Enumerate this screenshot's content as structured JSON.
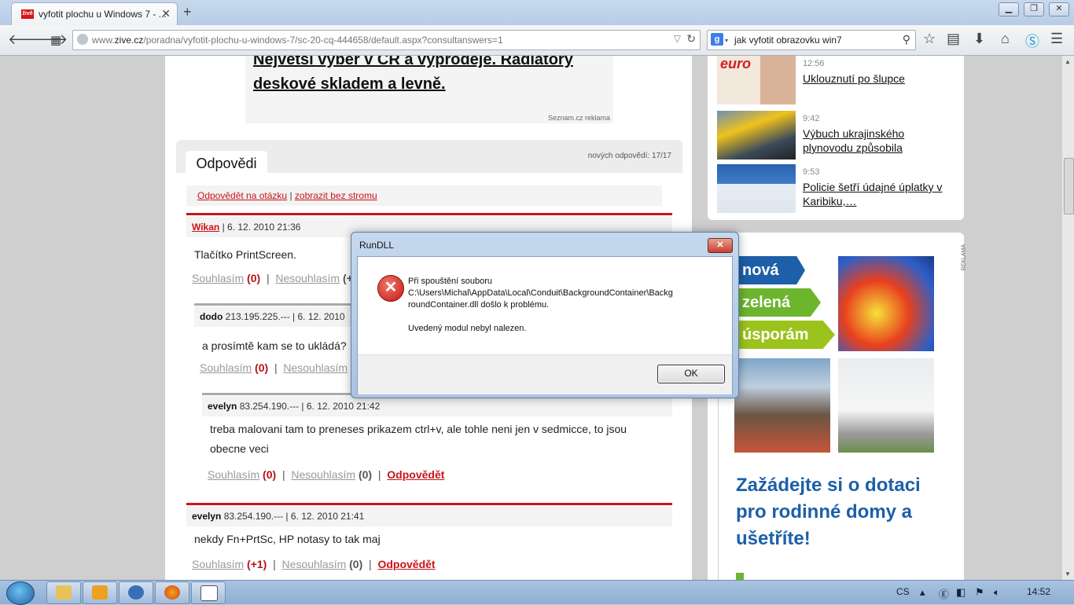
{
  "browser": {
    "tab_title": "vyfotit plochu u Windows 7 - ...",
    "tab_favicon_text": "živě",
    "new_tab_label": "+",
    "url_prefix": "www.",
    "url_domain": "zive.cz",
    "url_rest": "/poradna/vyfotit-plochu-u-windows-7/sc-20-cq-444658/default.aspx?consultanswers=1",
    "search_engine_letter": "g",
    "search_value": "jak vyfotit obrazovku win7"
  },
  "page": {
    "ad_top_text_line1": "Největší výběr v ČR a výprodeje. Radiátory",
    "ad_top_text_line2": "deskové skladem a levně.",
    "ad_top_source": "Seznam.cz reklama",
    "answers_tab": "Odpovědi",
    "answers_count": "nových odpovědí: 17/17",
    "link_reply_question": "Odpovědět na otázku",
    "link_separator": "|",
    "link_no_tree": "zobrazit bez stromu",
    "agree_label": "Souhlasím",
    "disagree_label": "Nesouhlasím",
    "reply_label": "Odpovědět",
    "sep": "|",
    "posts": [
      {
        "author": "Wikan",
        "meta": " | 6. 12. 2010 21:36",
        "body": "Tlačítko PrintScreen.",
        "agree": "(0)",
        "disagree": "(+"
      },
      {
        "author": "dodo",
        "meta": " 213.195.225.--- | 6. 12. 2010",
        "body": "a prosímtě kam se to ukládá?",
        "agree": "(0)",
        "disagree": ""
      },
      {
        "author": "evelyn",
        "meta": " 83.254.190.--- | 6. 12. 2010 21:42",
        "body": "treba malovani tam to preneses prikazem ctrl+v, ale tohle neni jen v sedmicce, to jsou obecne veci",
        "agree": "(0)",
        "disagree": "(0)"
      },
      {
        "author": "evelyn",
        "meta": " 83.254.190.--- | 6. 12. 2010 21:41",
        "body": "nekdy Fn+PrtSc, HP notasy to tak maj",
        "agree": "(+1)",
        "disagree": "(0)"
      }
    ]
  },
  "sidebar": {
    "news": [
      {
        "time": "12:56",
        "title": "Uklouznutí po šlupce",
        "thumb_text": "euro"
      },
      {
        "time": "9:42",
        "title": "Výbuch ukrajinského plynovodu způsobila",
        "thumb_text": ""
      },
      {
        "time": "9:53",
        "title": "Policie šetří údajné úplatky v Karibiku,…",
        "thumb_text": ""
      }
    ],
    "ad": {
      "reklama": "REKLAMA",
      "arrow1": "nová",
      "arrow2": "zelená",
      "arrow3": "úsporám",
      "headline": "Zažádejte si o dotaci pro rodinné domy a ušetříte!"
    }
  },
  "dialog": {
    "title": "RunDLL",
    "close_label": "✕",
    "message_line1": "Při spouštění souboru",
    "message_line2": "C:\\Users\\Michal\\AppData\\Local\\Conduit\\BackgroundContainer\\Backg",
    "message_line3": "roundContainer.dll došlo k problému.",
    "message_line4": "Uvedený modul nebyl nalezen.",
    "ok_label": "OK"
  },
  "taskbar": {
    "language": "CS",
    "clock": "14:52"
  },
  "colors": {
    "brand_red": "#c8141a",
    "ad_blue": "#1d5fa8",
    "ad_green": "#6cb52d"
  }
}
